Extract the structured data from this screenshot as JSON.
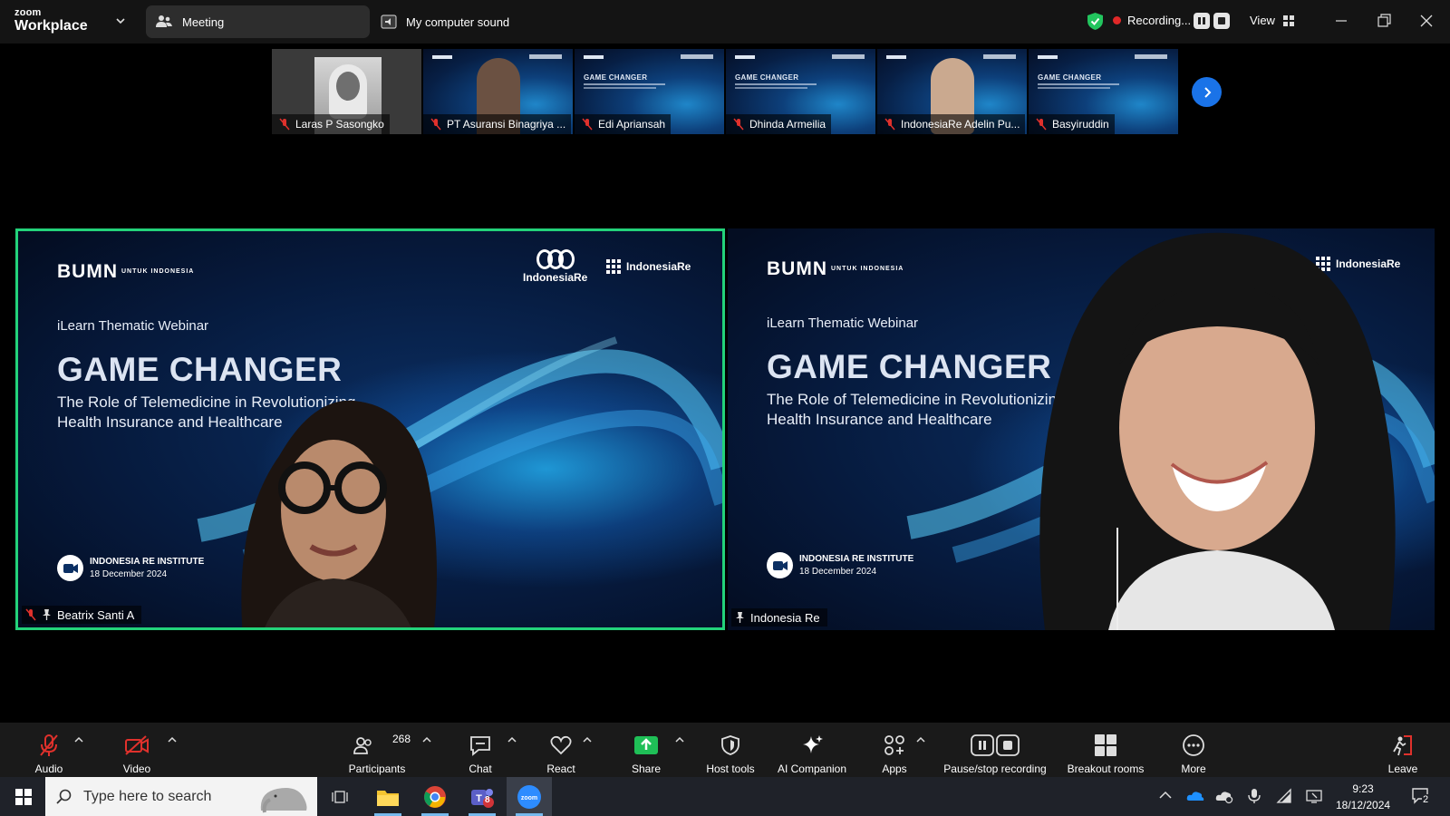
{
  "window": {
    "brand_line1": "zoom",
    "brand_line2": "Workplace",
    "meeting_label": "Meeting",
    "sound_label": "My computer sound",
    "recording_label": "Recording...",
    "view_label": "View"
  },
  "thumbnails": [
    {
      "name": "Laras P Sasongko",
      "kind": "person"
    },
    {
      "name": "PT Asuransi Binagriya ...",
      "kind": "slide-person"
    },
    {
      "name": "Edi Apriansah",
      "kind": "slide"
    },
    {
      "name": "Dhinda Armeilia",
      "kind": "slide"
    },
    {
      "name": "IndonesiaRe Adelin Pu...",
      "kind": "slide-person"
    },
    {
      "name": "Basyiruddin",
      "kind": "slide"
    }
  ],
  "slide": {
    "bumn": "BUMN",
    "bumn_tag": "UNTUK INDONESIA",
    "indonesiare": "IndonesiaRe",
    "institute": "IndonesiaRe",
    "kicker": "iLearn Thematic Webinar",
    "title": "GAME CHANGER",
    "subtitle_line1": "The Role of Telemedicine in Revolutionizing",
    "subtitle_line2": "Health Insurance and Healthcare",
    "footer_org": "INDONESIA RE INSTITUTE",
    "footer_date": "18 December 2024"
  },
  "tiles": {
    "left_name": "Beatrix Santi A",
    "right_name": "Indonesia Re"
  },
  "toolbar": {
    "audio": "Audio",
    "video": "Video",
    "participants": "Participants",
    "participants_count": "268",
    "chat": "Chat",
    "react": "React",
    "share": "Share",
    "host_tools": "Host tools",
    "ai_companion": "AI Companion",
    "apps": "Apps",
    "pause_stop": "Pause/stop recording",
    "breakout": "Breakout rooms",
    "more": "More",
    "leave": "Leave"
  },
  "taskbar": {
    "search_placeholder": "Type here to search",
    "teams_badge": "8",
    "time": "9:23",
    "date": "18/12/2024",
    "notification_count": "2"
  },
  "colors": {
    "active_speaker_border": "#23d27a",
    "share_green": "#1fbf57",
    "next_button": "#1a73e8",
    "recording_dot": "#e02828",
    "muted_red": "#e0312c"
  }
}
